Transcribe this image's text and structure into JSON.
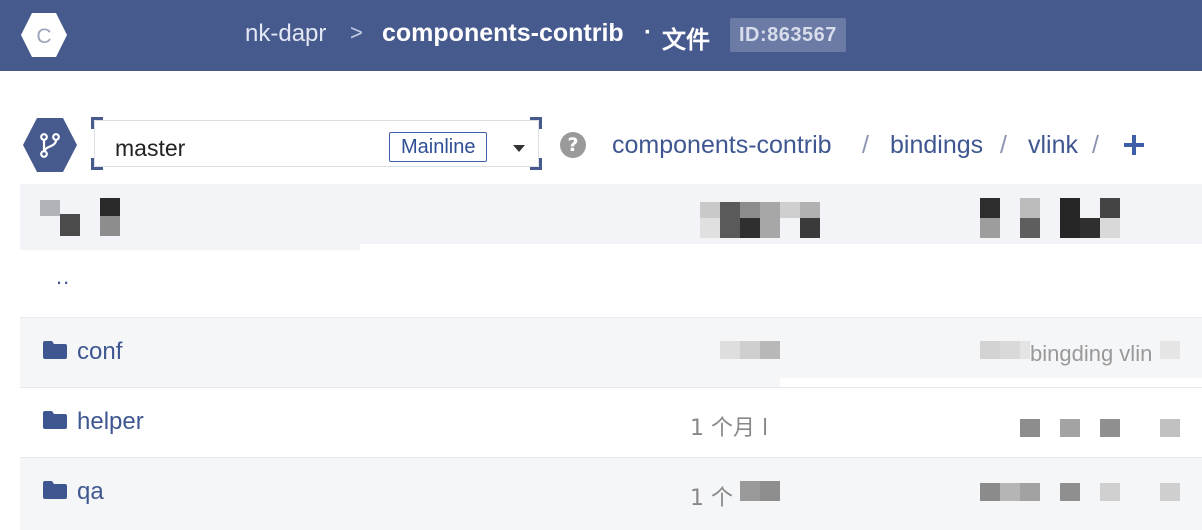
{
  "header": {
    "owner": "nk-dapr",
    "separator": ">",
    "repo": "components-contrib",
    "dot": "·",
    "section": "文件",
    "repo_id": "ID:863567",
    "logo_letter": "C"
  },
  "branch": {
    "name": "master",
    "tag": "Mainline",
    "help": "?"
  },
  "path": {
    "segments": [
      "components-contrib",
      "bindings",
      "vlink"
    ],
    "separator": "/"
  },
  "table": {
    "parent_link": "..",
    "rows": [
      {
        "name": "conf",
        "time": "",
        "message": "bingding vlin"
      },
      {
        "name": "helper",
        "time": "1 个月 l",
        "message": ""
      },
      {
        "name": "qa",
        "time": "1 个",
        "message": ""
      }
    ]
  },
  "colors": {
    "header_bg": "#475a8e",
    "accent": "#3f5791",
    "header_row_bg": "#f2f4f8"
  },
  "icons": [
    "logo-icon",
    "chevron-right-icon",
    "branch-icon",
    "caret-down-icon",
    "help-icon",
    "add-icon",
    "folder-icon"
  ]
}
